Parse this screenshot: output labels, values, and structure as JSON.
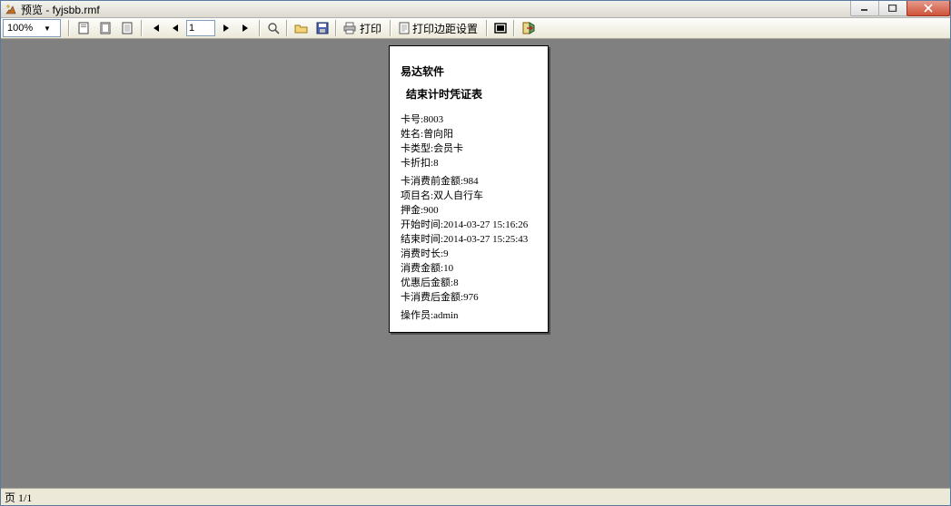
{
  "window": {
    "title": "预览 - fyjsbb.rmf"
  },
  "toolbar": {
    "zoom": "100%",
    "page_current": "1",
    "btn_print": "打印",
    "btn_page_setup": "打印边距设置"
  },
  "receipt": {
    "company": "易达软件",
    "title": "结束计时凭证表",
    "card_no_label": "卡号:",
    "card_no": "8003",
    "name_label": "姓名:",
    "name": "曾向阳",
    "card_type_label": "卡类型:",
    "card_type": "会员卡",
    "discount_label": "卡折扣:",
    "discount": "8",
    "balance_before_label": "卡消费前金额:",
    "balance_before": "984",
    "item_label": "项目名:",
    "item": "双人自行车",
    "deposit_label": "押金:",
    "deposit": "900",
    "start_time_label": "开始时间:",
    "start_time": "2014-03-27 15:16:26",
    "end_time_label": "结束时间:",
    "end_time": "2014-03-27 15:25:43",
    "duration_label": "消费时长:",
    "duration": "9",
    "amount_label": "消费金额:",
    "amount": "10",
    "after_discount_label": "优惠后金额:",
    "after_discount": "8",
    "balance_after_label": "卡消费后金额:",
    "balance_after": "976",
    "operator_label": "操作员:",
    "operator": "admin"
  },
  "status": {
    "page": "页 1/1"
  }
}
